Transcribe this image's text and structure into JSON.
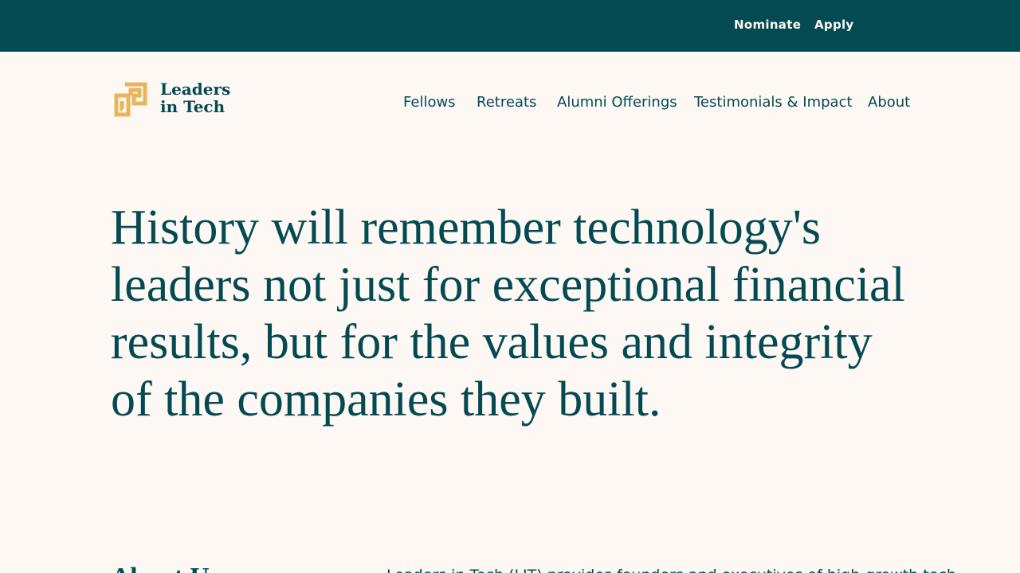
{
  "topbar": {
    "nominate_label": "Nominate",
    "apply_label": "Apply",
    "background": "#044a52"
  },
  "logo": {
    "line1": "Leaders",
    "line2": "in Tech",
    "icon": "interlocking-squares-logo-icon",
    "accent": "#e8b45c"
  },
  "nav": {
    "items": [
      {
        "label": "Fellows"
      },
      {
        "label": "Retreats"
      },
      {
        "label": "Alumni Offerings"
      },
      {
        "label": "Testimonials & Impact"
      },
      {
        "label": "About"
      }
    ]
  },
  "hero": {
    "headline": "History will remember technology's leaders not just for exceptional financial results, but for the values and integrity of the companies they built."
  },
  "about": {
    "heading": "About Us",
    "intro": "Leaders in Tech (LIT) provides founders and executives of high-growth tech"
  },
  "colors": {
    "page_background": "#fdf8f4",
    "text": "#044a52"
  }
}
